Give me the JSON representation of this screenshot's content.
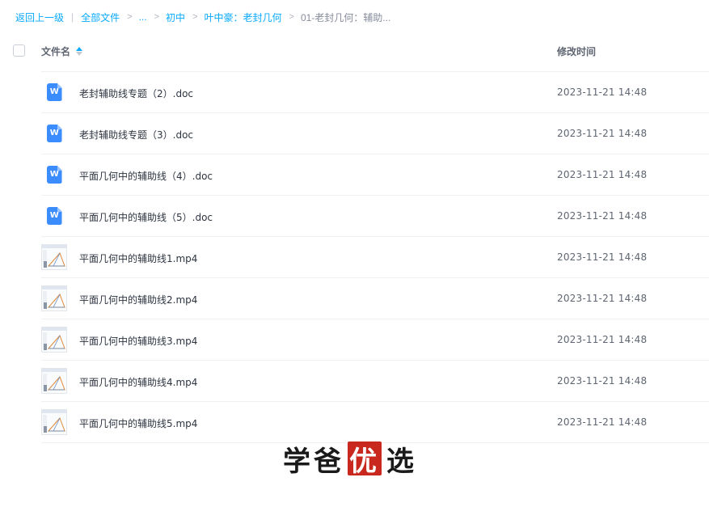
{
  "breadcrumb": {
    "back": "返回上一级",
    "items": [
      "全部文件",
      "...",
      "初中",
      "叶中豪：老封几何"
    ],
    "current": "01-老封几何：辅助..."
  },
  "table": {
    "col_name": "文件名",
    "col_time": "修改时间",
    "rows": [
      {
        "name": "老封辅助线专题（2）.doc",
        "time": "2023-11-21 14:48",
        "type": "doc-icon"
      },
      {
        "name": "老封辅助线专题（3）.doc",
        "time": "2023-11-21 14:48",
        "type": "doc-icon"
      },
      {
        "name": "平面几何中的辅助线（4）.doc",
        "time": "2023-11-21 14:48",
        "type": "doc-icon"
      },
      {
        "name": "平面几何中的辅助线（5）.doc",
        "time": "2023-11-21 14:48",
        "type": "doc-icon"
      },
      {
        "name": "平面几何中的辅助线1.mp4",
        "time": "2023-11-21 14:48",
        "type": "video-thumbnail"
      },
      {
        "name": "平面几何中的辅助线2.mp4",
        "time": "2023-11-21 14:48",
        "type": "video-thumbnail"
      },
      {
        "name": "平面几何中的辅助线3.mp4",
        "time": "2023-11-21 14:48",
        "type": "video-thumbnail"
      },
      {
        "name": "平面几何中的辅助线4.mp4",
        "time": "2023-11-21 14:48",
        "type": "video-thumbnail"
      },
      {
        "name": "平面几何中的辅助线5.mp4",
        "time": "2023-11-21 14:48",
        "type": "video-thumbnail"
      }
    ]
  },
  "watermark": {
    "part1": "学爸",
    "highlight": "优",
    "part2": "选"
  },
  "colors": {
    "accent": "#09aaff",
    "doc_icon": "#3b8cff",
    "watermark_red": "#c8281e"
  }
}
